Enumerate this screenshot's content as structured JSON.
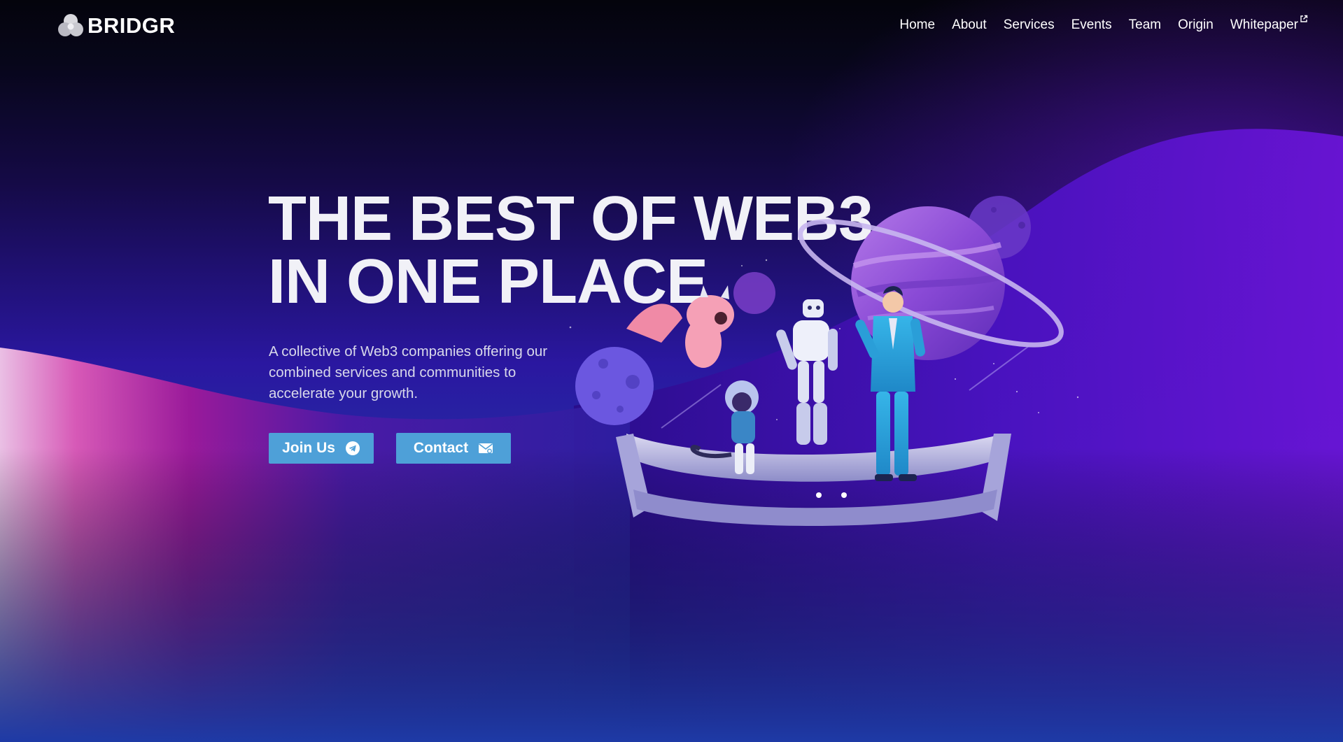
{
  "header": {
    "brand": "BRIDGR",
    "nav": [
      {
        "label": "Home"
      },
      {
        "label": "About"
      },
      {
        "label": "Services"
      },
      {
        "label": "Events"
      },
      {
        "label": "Team"
      },
      {
        "label": "Origin"
      },
      {
        "label": "Whitepaper",
        "icon": "external-link-icon"
      }
    ]
  },
  "hero": {
    "title_line1": "THE BEST OF WEB3",
    "title_line2": "IN ONE PLACE",
    "subtitle": "A collective of Web3 companies offering our combined services and communities to accelerate your growth.",
    "buttons": [
      {
        "label": "Join Us",
        "icon": "telegram-icon"
      },
      {
        "label": "Contact",
        "icon": "mail-icon"
      }
    ]
  },
  "colors": {
    "button": "#4ea0d8",
    "background_top": "#04040c",
    "background_bottom": "#1e3aa6",
    "purple_wave": "#5a10c8",
    "pink_wave": "#d8208a"
  }
}
